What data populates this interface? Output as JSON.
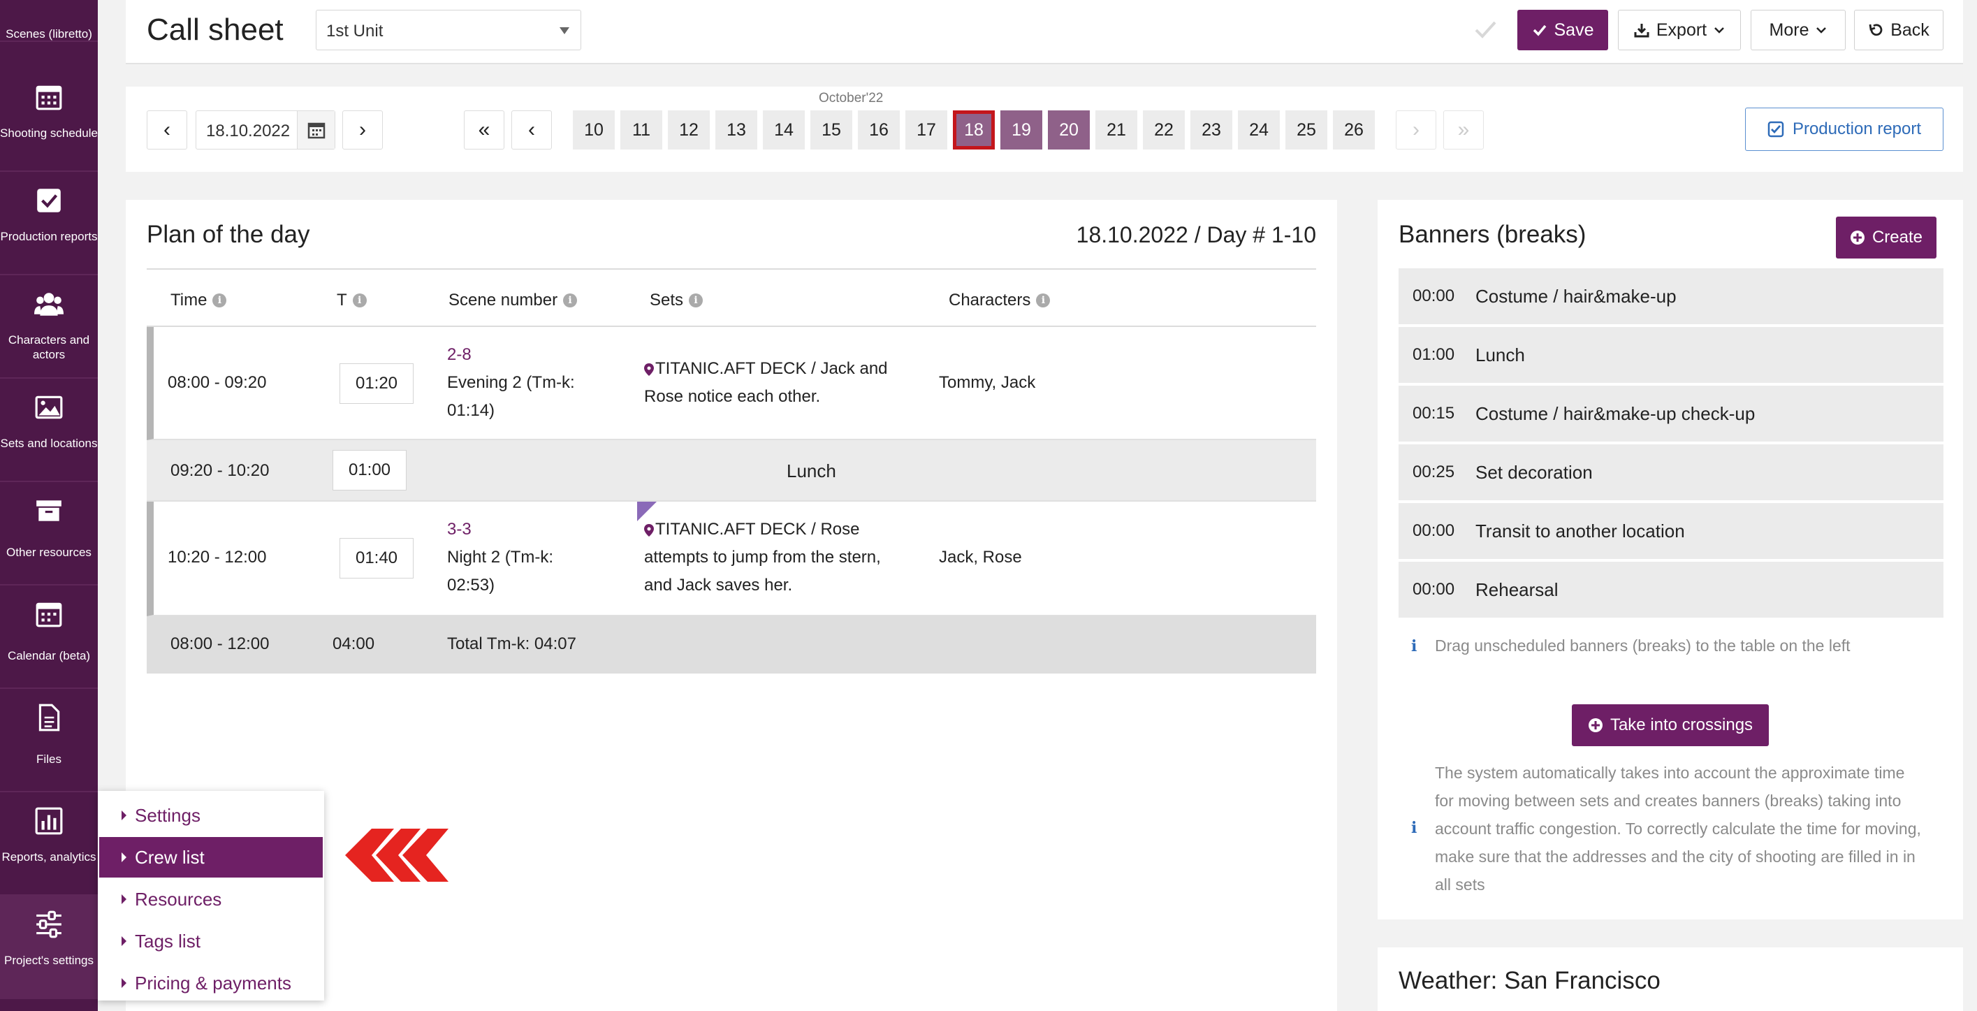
{
  "sidebar": {
    "items": [
      {
        "label": "Scenes (libretto)",
        "icon": "scenes-icon"
      },
      {
        "label": "Shooting schedule",
        "icon": "calendar-icon"
      },
      {
        "label": "Production reports",
        "icon": "check-square-icon"
      },
      {
        "label": "Characters and actors",
        "icon": "users-icon"
      },
      {
        "label": "Sets and locations",
        "icon": "image-icon"
      },
      {
        "label": "Other resources",
        "icon": "archive-icon"
      },
      {
        "label": "Calendar (beta)",
        "icon": "calendar-icon"
      },
      {
        "label": "Files",
        "icon": "file-icon"
      },
      {
        "label": "Reports, analytics",
        "icon": "chart-icon"
      },
      {
        "label": "Project's settings",
        "icon": "sliders-icon"
      }
    ]
  },
  "header": {
    "title": "Call sheet",
    "unit_select": "1st Unit",
    "save": "Save",
    "export": "Export",
    "more": "More",
    "back": "Back"
  },
  "datebar": {
    "date": "18.10.2022",
    "month": "October'22",
    "days": [
      "10",
      "11",
      "12",
      "13",
      "14",
      "15",
      "16",
      "17",
      "18",
      "19",
      "20",
      "21",
      "22",
      "23",
      "24",
      "25",
      "26"
    ],
    "selected_day": "18",
    "highlighted_days": [
      "19",
      "20"
    ],
    "production_report": "Production report",
    "prev": "‹",
    "next": "›",
    "first": "«",
    "last": "»"
  },
  "plan": {
    "title": "Plan of the day",
    "date_info": "18.10.2022 / Day # 1-10",
    "columns": [
      "Time",
      "T",
      "Scene number",
      "Sets",
      "Characters"
    ],
    "rows": [
      {
        "type": "scene",
        "time": "08:00 - 09:20",
        "t": "01:20",
        "scene_no": "2-8",
        "scene_desc_1": "Evening 2 (Tm-k:",
        "scene_desc_2": "01:14)",
        "set_1": "TITANIC.AFT DECK / Jack and",
        "set_2": "Rose notice each other.",
        "set_3": "",
        "characters": "Tommy, Jaсk"
      },
      {
        "type": "banner",
        "time": "09:20 - 10:20",
        "t": "01:00",
        "label": "Lunch"
      },
      {
        "type": "scene",
        "time": "10:20 - 12:00",
        "t": "01:40",
        "scene_no": "3-3",
        "scene_desc_1": "Night 2 (Tm-k:",
        "scene_desc_2": "02:53)",
        "set_1": "TITANIC.AFT DECK / Rose",
        "set_2": "attempts to jump from the stern,",
        "set_3": "and Jack saves her.",
        "characters": "Jaсk, Rose"
      },
      {
        "type": "total",
        "time": "08:00 - 12:00",
        "t": "04:00",
        "label": "Total Tm-k: 04:07"
      }
    ]
  },
  "banners": {
    "title": "Banners (breaks)",
    "create": "Create",
    "items": [
      {
        "duration": "00:00",
        "name": "Costume / hair&make-up"
      },
      {
        "duration": "01:00",
        "name": "Lunch"
      },
      {
        "duration": "00:15",
        "name": "Costume / hair&make-up check-up"
      },
      {
        "duration": "00:25",
        "name": "Set decoration"
      },
      {
        "duration": "00:00",
        "name": "Transit to another location"
      },
      {
        "duration": "00:00",
        "name": "Rehearsal"
      }
    ],
    "drag_hint": "Drag unscheduled banners (breaks) to the table on the left",
    "take_crossings": "Take into crossings",
    "system_hint": [
      "The system automatically takes into account the approximate time",
      "for moving between sets and creates banners (breaks) taking into",
      "account traffic congestion. To correctly calculate the time for moving,",
      "make sure that the addresses and the city of shooting are filled in in",
      "all sets"
    ]
  },
  "weather": {
    "title": "Weather: San Francisco"
  },
  "settings_menu": {
    "items": [
      "Settings",
      "Crew list",
      "Resources",
      "Tags list",
      "Pricing & payments"
    ],
    "active": "Crew list"
  },
  "colors": {
    "brand": "#6e1f66",
    "sidebar": "#4d1848",
    "selected_day_border": "#c4161c",
    "arrow": "#e52420"
  }
}
